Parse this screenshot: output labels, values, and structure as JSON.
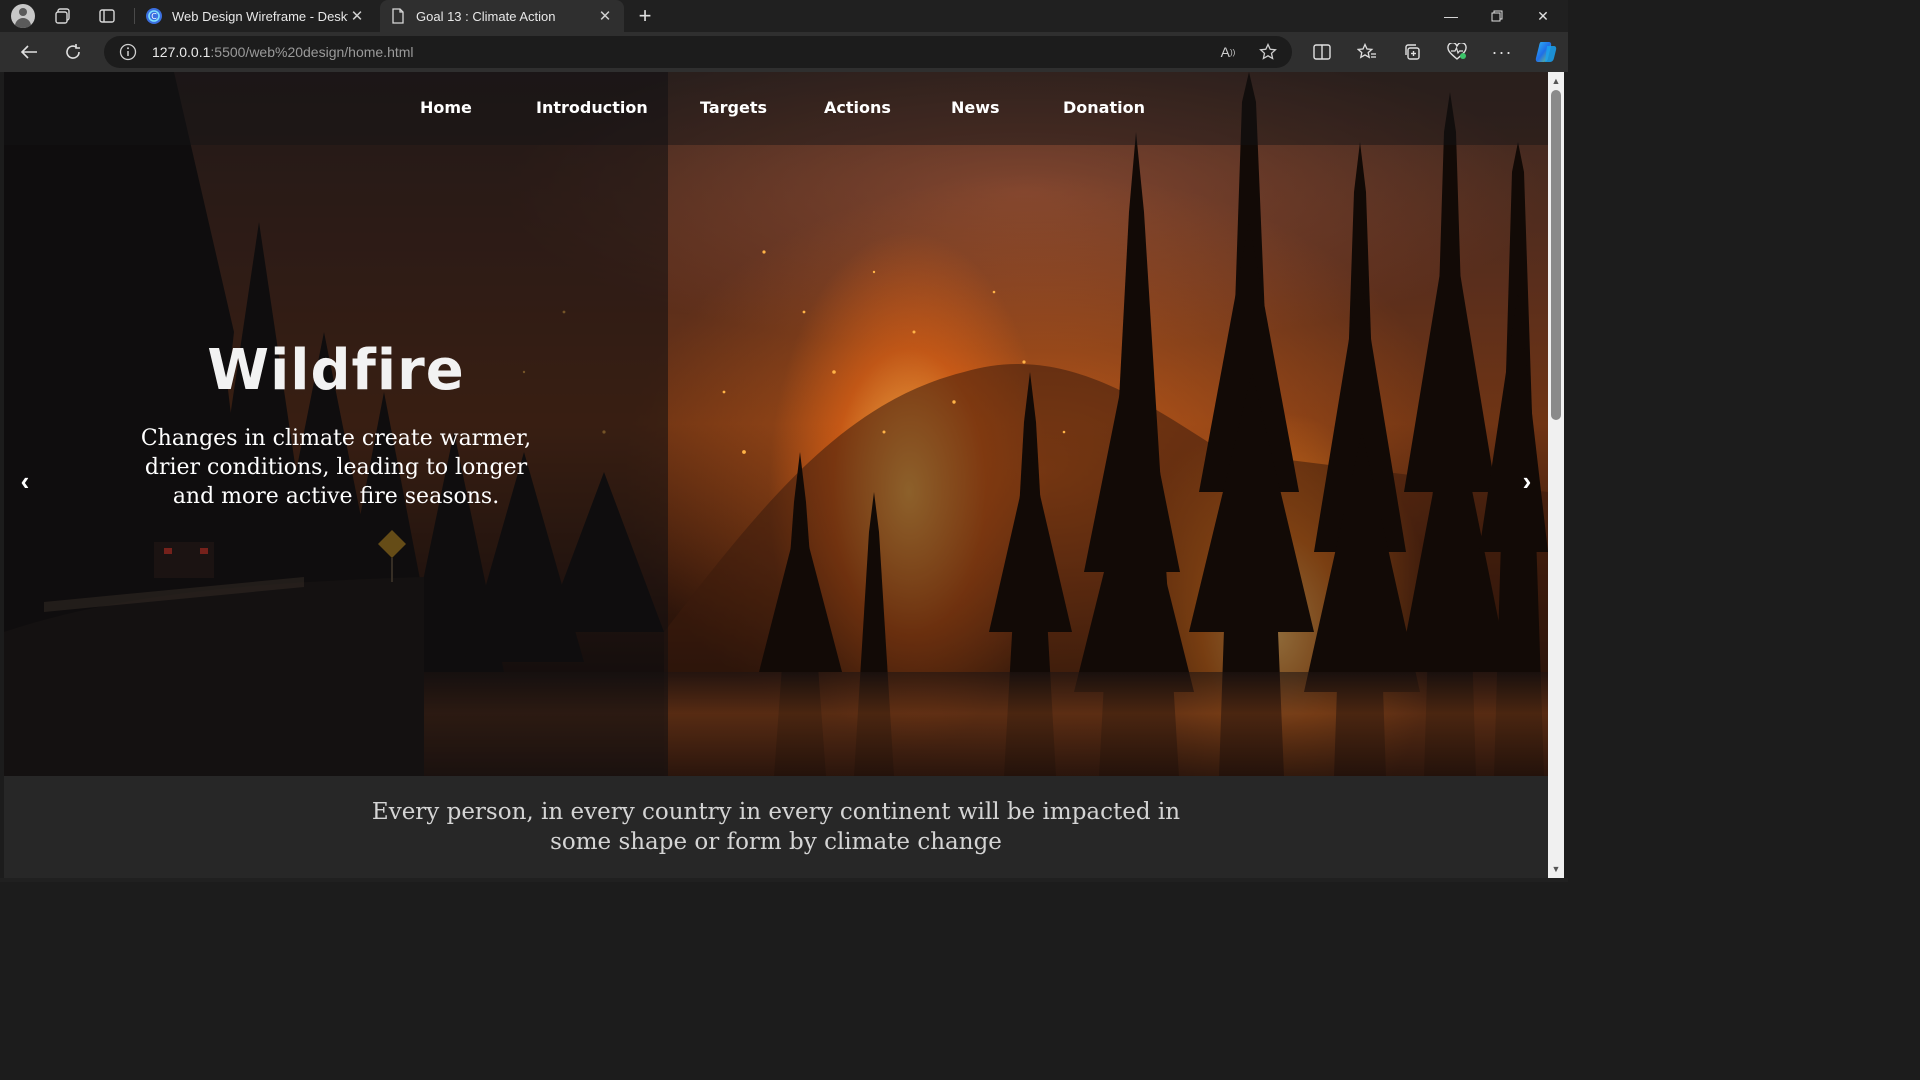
{
  "browser": {
    "tabs": [
      {
        "title": "Web Design Wireframe - Desktop",
        "icon": "canva-icon",
        "active": false
      },
      {
        "title": "Goal 13 : Climate Action",
        "icon": "page-icon",
        "active": true
      }
    ],
    "url_host": "127.0.0.1",
    "url_rest": ":5500/web%20design/home.html"
  },
  "nav": {
    "items": [
      "Home",
      "Introduction",
      "Targets",
      "Actions",
      "News",
      "Donation"
    ]
  },
  "hero": {
    "title": "Wildfire",
    "description": "Changes in climate create warmer, drier conditions, leading to longer and more active fire seasons."
  },
  "tagline": "Every person, in every country in every continent will be impacted in some shape or form by climate change",
  "colors": {
    "chrome_bg": "#202020",
    "toolbar_bg": "#2f2f2f",
    "page_footer_bg": "#272727",
    "fire_orange": "#ff8c1e"
  }
}
